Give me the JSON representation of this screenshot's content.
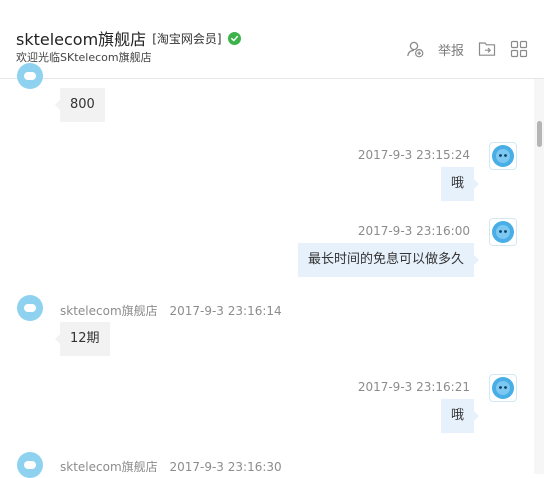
{
  "header": {
    "shop_name": "sktelecom旗舰店",
    "member_badge": "[淘宝网会员]",
    "subtitle": "欢迎光临SKtelecom旗舰店",
    "report_label": "举报"
  },
  "messages": [
    {
      "side": "left",
      "text": "800"
    },
    {
      "side": "right",
      "time": "2017-9-3 23:15:24",
      "text": "哦"
    },
    {
      "side": "right",
      "time": "2017-9-3 23:16:00",
      "text": "最长时间的免息可以做多久"
    },
    {
      "side": "left",
      "sender": "sktelecom旗舰店",
      "time": "2017-9-3 23:16:14",
      "text": "12期"
    },
    {
      "side": "right",
      "time": "2017-9-3 23:16:21",
      "text": "哦"
    },
    {
      "side": "left",
      "sender": "sktelecom旗舰店",
      "time": "2017-9-3 23:16:30"
    }
  ],
  "colors": {
    "verified": "#3cb34a",
    "shop_avatar": "#8fd2ef",
    "user_avatar": "#49aee6",
    "incoming_bubble": "#f2f2f2",
    "outgoing_bubble": "#e6f1fb"
  },
  "icons": [
    "add-contact-icon",
    "forward-icon",
    "grid-icon",
    "verified-icon"
  ]
}
